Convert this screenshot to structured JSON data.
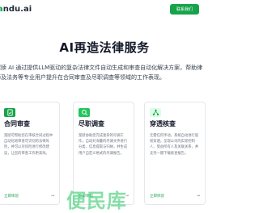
{
  "nav": {
    "brand_prefix": "",
    "brand_accent": "a",
    "brand_rest": "ndu.ai",
    "contact_label": "联系我们"
  },
  "hero": {
    "title": "AI再造法律服务",
    "desc_line1": "案牍 AI 通过提供LLM驱动的复杂法律文件自动生成和审查自动化解决方案，帮助律",
    "desc_line2": "师及法务等专业用户提升在合同审查及尽职调查等领域的工作表现。"
  },
  "cards": [
    {
      "title": "合同审查",
      "text": "案牍可帮助您在审核合同过程中自动化地审查可识别的法律风险，并可以对风险进行修改建议，让您的审查工作更高效。",
      "link": "立即体验",
      "arrow": "→",
      "icon": "document-check-icon"
    },
    {
      "title": "尽职调查",
      "text": "案牍协助您完成复杂的尽调工作，自动对海量的尽调文件进行分类、信息提取与归纳，并生成用户自定义格式的尽调报告。",
      "link": "立即体验",
      "arrow": "→",
      "icon": "magnifier-icon"
    },
    {
      "title": "穿透核查",
      "text": "无需任何手动，系统自动进行股权穿透，呈现公司的实际控制人、受益所有人及关联关系，并支持一键下载核查报告。",
      "link": "立即体验",
      "arrow": "→",
      "icon": "network-icon"
    }
  ],
  "watermark": "便民库",
  "colors": {
    "accent": "#16a34a",
    "icon_bg_1": "#16a34a",
    "icon_bg_2": "#22c55e",
    "icon_bg_3": "#dcfce7"
  }
}
